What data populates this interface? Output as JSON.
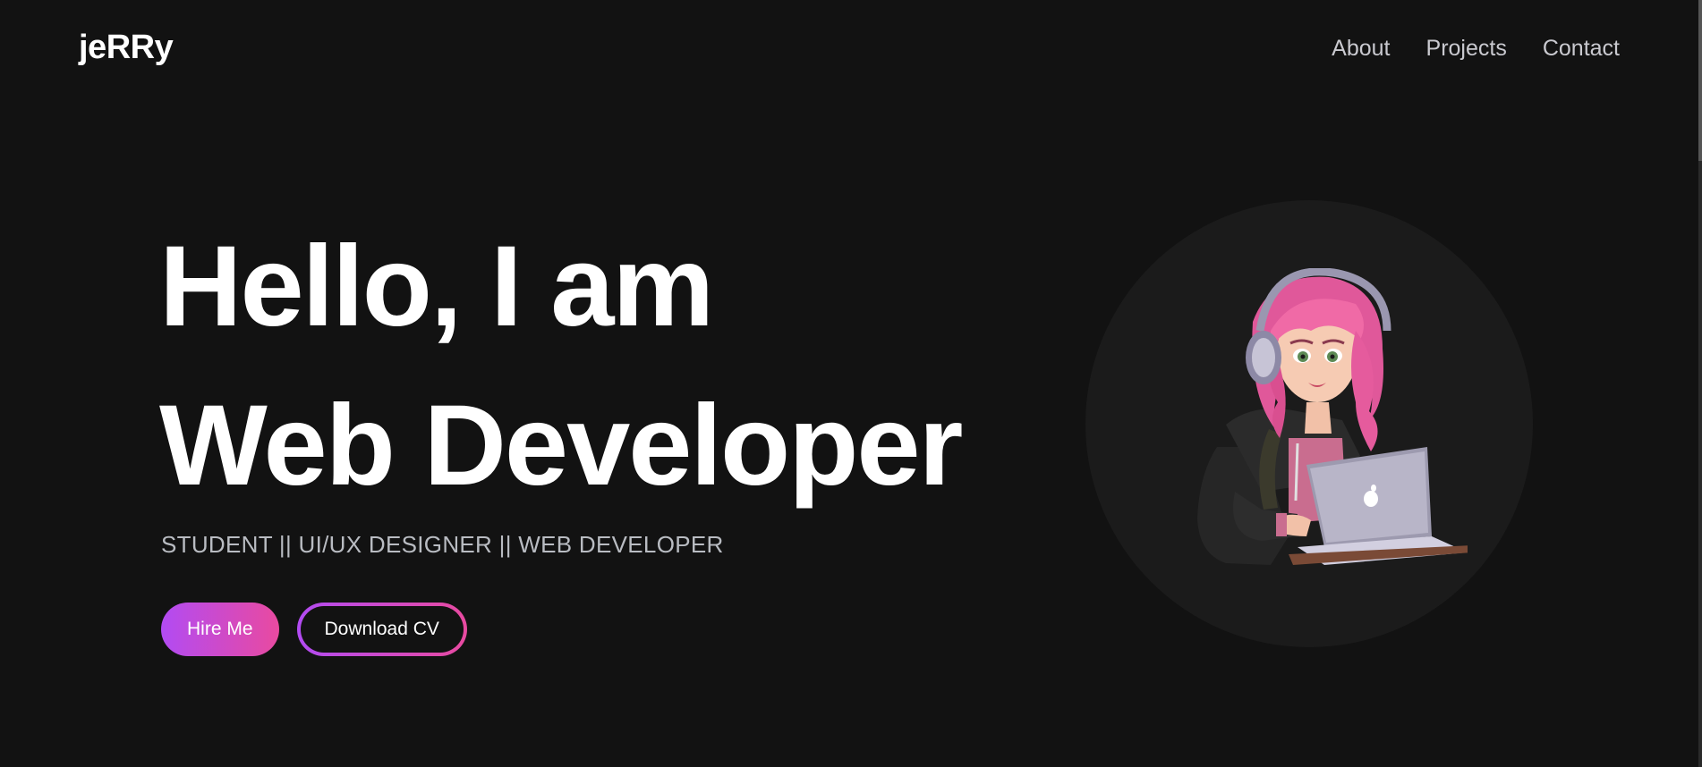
{
  "nav": {
    "logo": "jeRRy",
    "links": [
      "About",
      "Projects",
      "Contact"
    ]
  },
  "hero": {
    "line1": "Hello, I am",
    "line2": "Web Developer",
    "subtitle": "STUDENT || UI/UX DESIGNER || WEB DEVELOPER",
    "primary_button": "Hire Me",
    "secondary_button": "Download CV"
  },
  "colors": {
    "background": "#121212",
    "accent_start": "#b24bf3",
    "accent_end": "#e94aa0",
    "avatar_bg": "#1b1b1b"
  },
  "icons": {
    "avatar": "girl-with-laptop-illustration"
  }
}
